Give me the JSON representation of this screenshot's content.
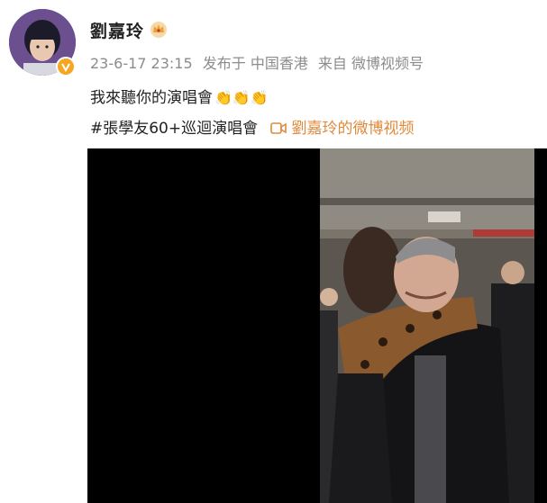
{
  "post": {
    "username": "劉嘉玲",
    "time": "23-6-17 23:15",
    "published": "发布于 中国香港",
    "source": "来自 微博视频号",
    "text": "我來聽你的演唱會",
    "claps": "👏👏👏",
    "hashtag": "#張學友60+巡迴演唱會",
    "video_link": "劉嘉玲的微博视频"
  },
  "colors": {
    "link": "#e08a3c",
    "verified": "#f5a623",
    "meta": "#8c8c8c"
  },
  "icons": [
    "verified-badge-icon",
    "crown-icon",
    "video-icon"
  ]
}
